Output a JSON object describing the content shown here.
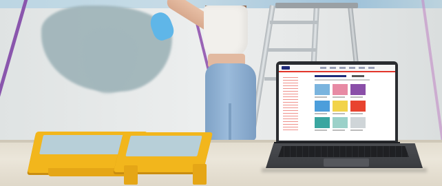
{
  "scene": {
    "colors": {
      "wall": "#e3e6e6",
      "paint_blue": "#9fb4b9",
      "masking_tape": "#8a56ad",
      "tray_yellow": "#f2b61c",
      "tray_paint": "#b7cfd8",
      "denim": "#8daed0",
      "tank_top": "#f2f0ec",
      "skin": "#e2b9a0",
      "glove": "#5fb6e8",
      "ladder": "#c9ced1",
      "table_cloth": "#e9e4d8",
      "laptop_body": "#3a3c40",
      "laptop_screen": "#ffffff",
      "site_accent_red": "#e2352a",
      "site_navy": "#1e2a78"
    },
    "laptop": {
      "screen_text_legible": false
    }
  }
}
